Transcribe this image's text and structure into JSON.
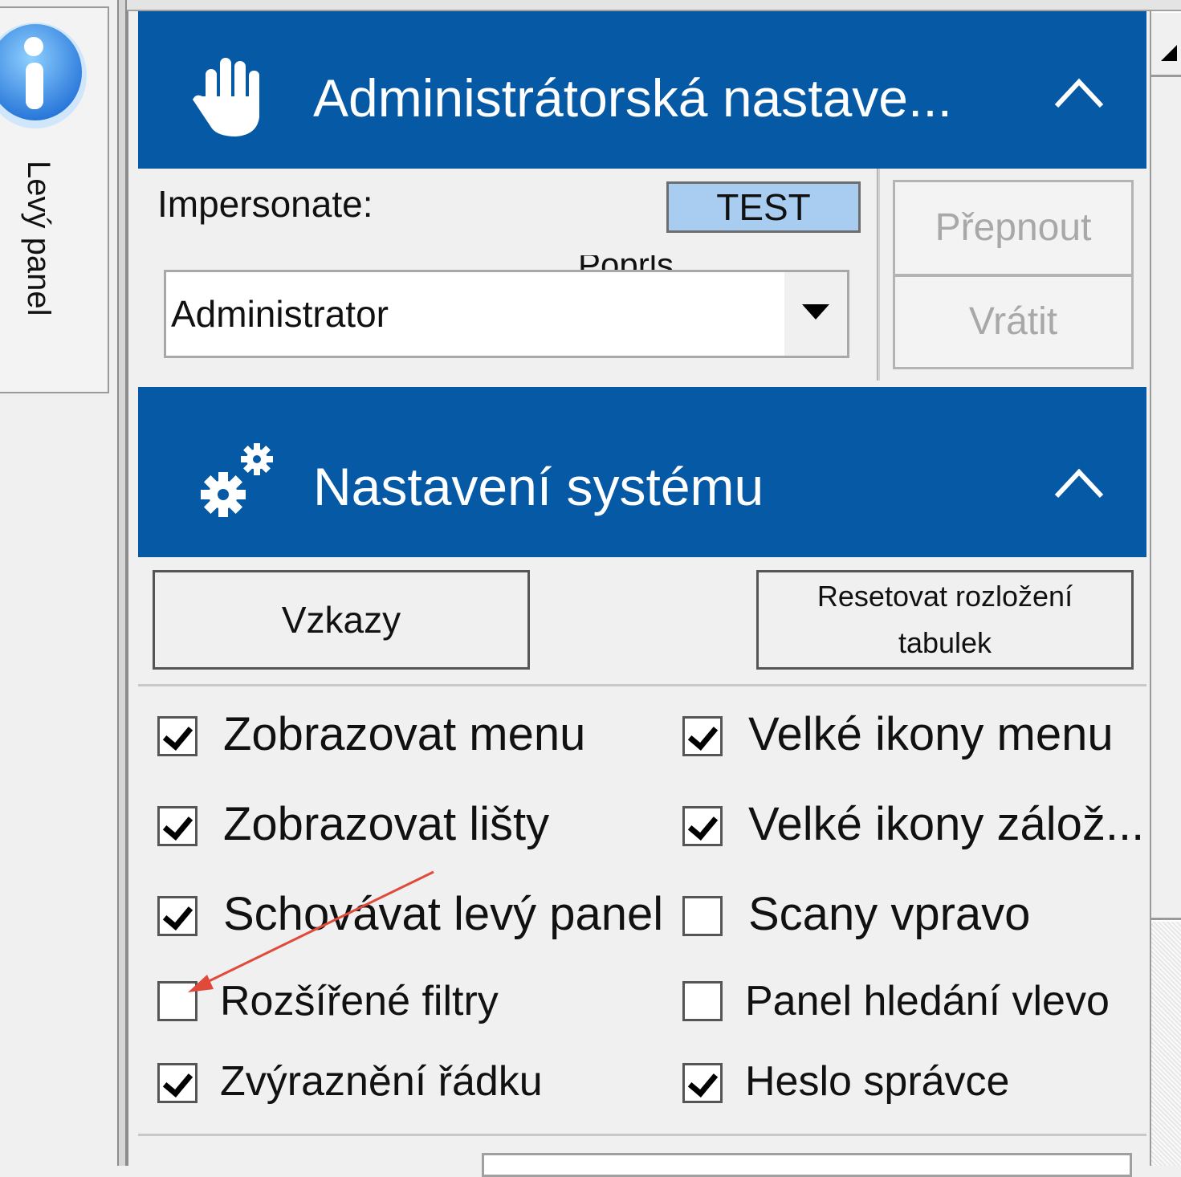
{
  "side_tab": {
    "label": "Levý panel",
    "icon": "info-icon"
  },
  "admin_section": {
    "title": "Administrátorská nastave...",
    "icon": "hand-icon",
    "collapse_icon": "chevron-up-icon",
    "impersonate_label": "Impersonate:",
    "badge": "TEST",
    "hidden_label": "Poprls",
    "user_select": {
      "value": "Administrator"
    },
    "switch_button": "Přepnout",
    "revert_button": "Vrátit"
  },
  "system_section": {
    "title": "Nastavení systému",
    "icon": "gears-icon",
    "collapse_icon": "chevron-up-icon",
    "messages_button": "Vzkazy",
    "reset_button_line1": "Resetovat rozložení",
    "reset_button_line2": "tabulek",
    "left_options": [
      {
        "label": "Zobrazovat menu",
        "checked": true
      },
      {
        "label": "Zobrazovat lišty",
        "checked": true
      },
      {
        "label": "Schovávat levý panel",
        "checked": true
      },
      {
        "label": "Rozšířené filtry",
        "checked": false
      },
      {
        "label": "Zvýraznění řádku",
        "checked": true
      }
    ],
    "right_options": [
      {
        "label": "Velké ikony menu",
        "checked": true
      },
      {
        "label": "Velké ikony zálož...",
        "checked": true
      },
      {
        "label": "Scany vpravo",
        "checked": false
      },
      {
        "label": "Panel hledání vlevo",
        "checked": false
      },
      {
        "label": "Heslo správce",
        "checked": true
      }
    ]
  },
  "colors": {
    "header_bg": "#0659a4",
    "badge_bg": "#a9cdf1",
    "annotation": "#e04a3a"
  }
}
